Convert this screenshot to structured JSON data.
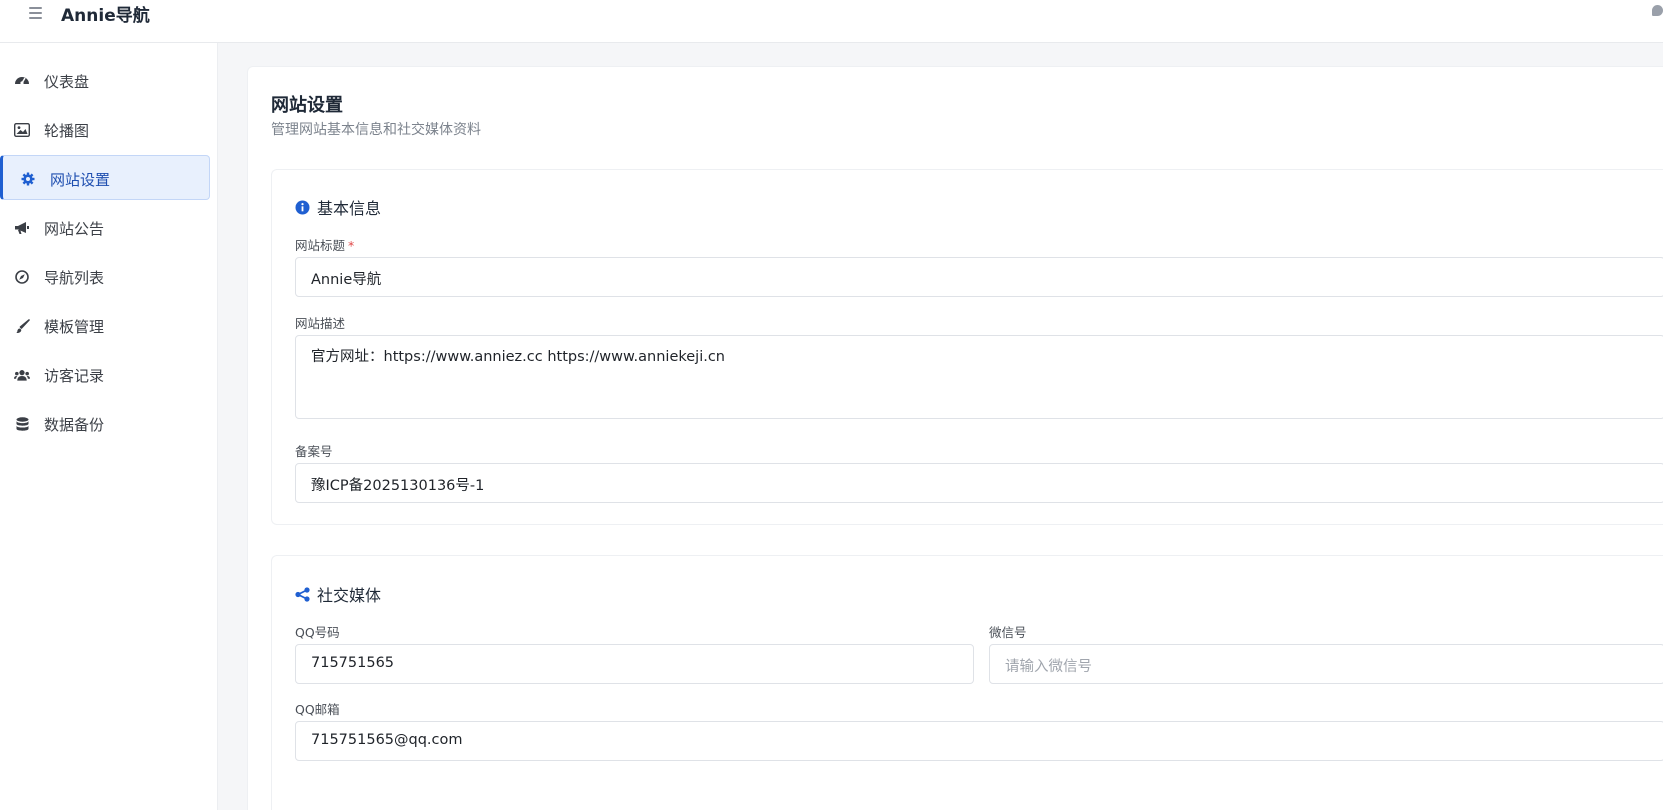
{
  "header": {
    "brand": "Annie导航"
  },
  "sidebar": {
    "items": [
      {
        "label": "仪表盘",
        "icon": "dashboard-icon"
      },
      {
        "label": "轮播图",
        "icon": "image-icon"
      },
      {
        "label": "网站设置",
        "icon": "gear-icon",
        "active": true
      },
      {
        "label": "网站公告",
        "icon": "megaphone-icon"
      },
      {
        "label": "导航列表",
        "icon": "compass-icon"
      },
      {
        "label": "模板管理",
        "icon": "paintbrush-icon"
      },
      {
        "label": "访客记录",
        "icon": "users-icon"
      },
      {
        "label": "数据备份",
        "icon": "database-icon"
      }
    ]
  },
  "page": {
    "title": "网站设置",
    "subtitle": "管理网站基本信息和社交媒体资料"
  },
  "basic": {
    "title": "基本信息",
    "site_title_label": "网站标题",
    "required_mark": "*",
    "site_title_value": "Annie导航",
    "site_desc_label": "网站描述",
    "site_desc_value": "官方网址：https://www.anniez.cc  https://www.anniekeji.cn",
    "icp_label": "备案号",
    "icp_value": "豫ICP备2025130136号-1"
  },
  "social": {
    "title": "社交媒体",
    "qq_label": "QQ号码",
    "qq_value": "715751565",
    "wechat_label": "微信号",
    "wechat_placeholder": "请输入微信号",
    "email_label": "QQ邮箱",
    "email_value": "715751565@qq.com"
  },
  "colors": {
    "accent": "#1f5fd1",
    "active_bg": "#e8f0fd",
    "required": "#e04848"
  }
}
